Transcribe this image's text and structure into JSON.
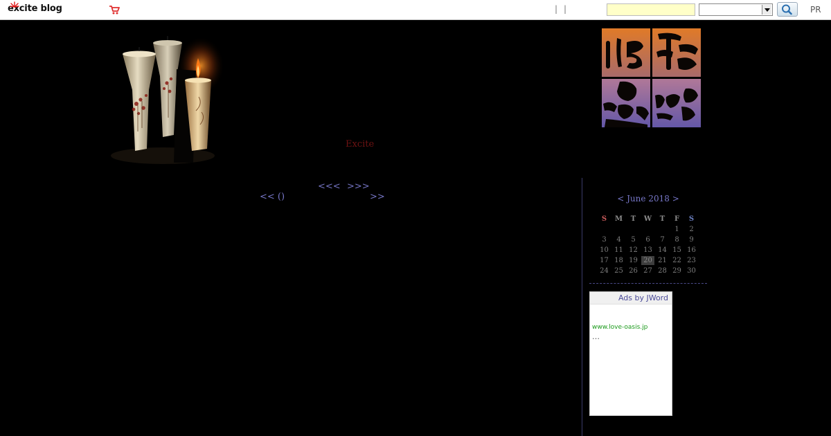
{
  "topbar": {
    "logo_text": "excite blog",
    "separators": [
      "|",
      "|"
    ],
    "search_placeholder": "",
    "search_select_value": "",
    "pr_label": "PR"
  },
  "header": {
    "excite_link": "Excite"
  },
  "nav": {
    "prev_month": "<<<",
    "next_month": ">>>",
    "prev_page": "<< ()",
    "next_page": ">>"
  },
  "calendar": {
    "prev": "<",
    "title": "June 2018",
    "next": ">",
    "weekdays": [
      "S",
      "M",
      "T",
      "W",
      "T",
      "F",
      "S"
    ],
    "weeks": [
      [
        "",
        "",
        "",
        "",
        "",
        "1",
        "2"
      ],
      [
        "3",
        "4",
        "5",
        "6",
        "7",
        "8",
        "9"
      ],
      [
        "10",
        "11",
        "12",
        "13",
        "14",
        "15",
        "16"
      ],
      [
        "17",
        "18",
        "19",
        "20",
        "21",
        "22",
        "23"
      ],
      [
        "24",
        "25",
        "26",
        "27",
        "28",
        "29",
        "30"
      ]
    ],
    "today": "20"
  },
  "ad": {
    "header": "Ads by JWord",
    "url": "www.love-oasis.jp",
    "ellipsis": "…"
  },
  "colors": {
    "background": "#000000",
    "link": "#7777c8",
    "excite_link": "#6e1212",
    "ad_url": "#1a9a1a"
  }
}
